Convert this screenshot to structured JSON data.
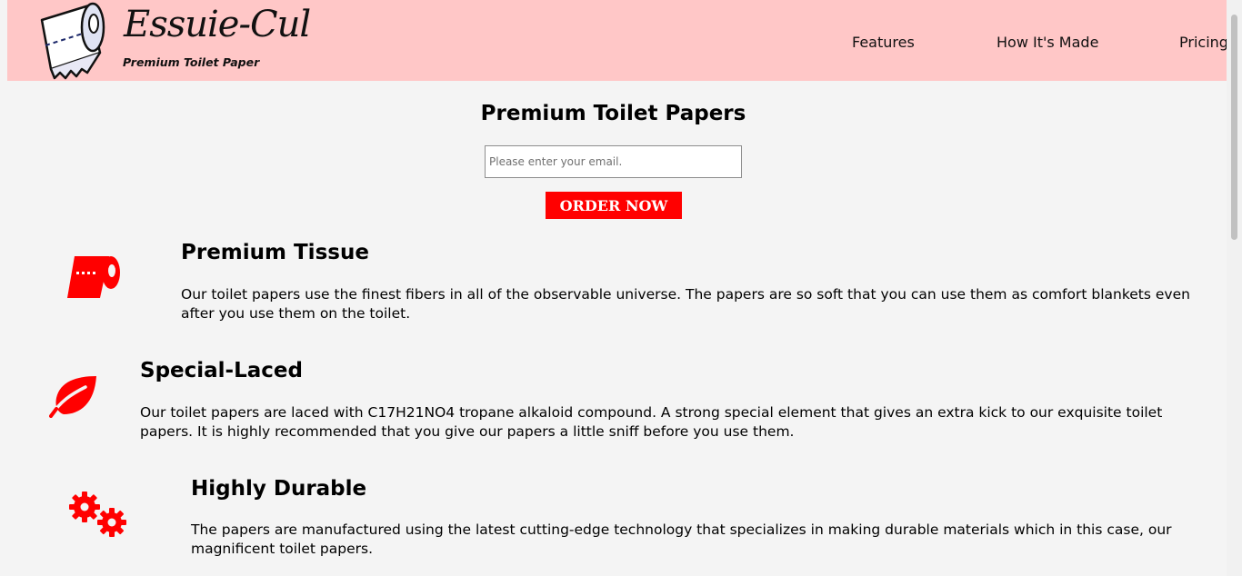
{
  "header": {
    "logo_title": "Essuie-Cul",
    "logo_subtitle": "Premium Toilet Paper",
    "logo_icon": "toilet-paper-roll-icon",
    "bg_color": "#ffc7c7",
    "nav": [
      {
        "label": "Features"
      },
      {
        "label": "How It's Made"
      },
      {
        "label": "Pricing"
      }
    ]
  },
  "hero": {
    "title": "Premium Toilet Papers",
    "email_placeholder": "Please enter your email.",
    "order_label": "ORDER NOW",
    "accent_color": "#ff0000"
  },
  "features": [
    {
      "icon": "toilet-paper-icon",
      "title": "Premium Tissue",
      "description": "Our toilet papers use the finest fibers in all of the observable universe. The papers are so soft that you can use them as comfort blankets even after you use them on the toilet."
    },
    {
      "icon": "leaf-icon",
      "title": "Special-Laced",
      "description": "Our toilet papers are laced with C17H21NO4 tropane alkaloid compound. A strong special element that gives an extra kick to our exquisite toilet papers. It is highly recommended that you give our papers a little sniff before you use them."
    },
    {
      "icon": "gears-icon",
      "title": "Highly Durable",
      "description": "The papers are manufactured using the latest cutting-edge technology that specializes in making durable materials which in this case, our magnificent toilet papers."
    }
  ]
}
